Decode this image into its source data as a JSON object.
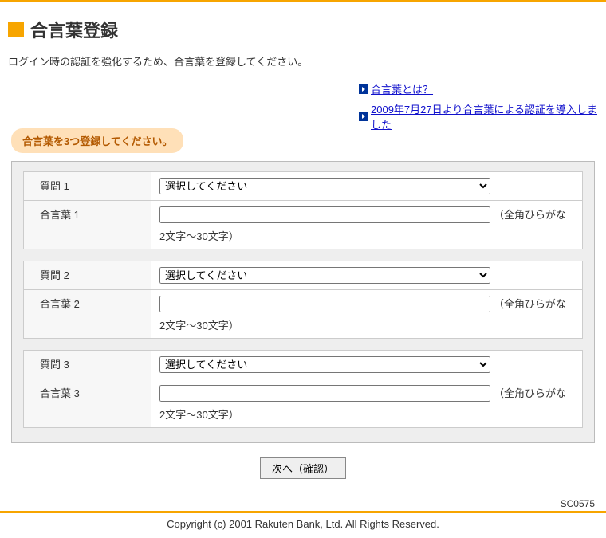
{
  "header": {
    "title": "合言葉登録"
  },
  "description": "ログイン時の認証を強化するため、合言葉を登録してください。",
  "links": {
    "whatIs": "合言葉とは？",
    "notice": "2009年7月27日より合言葉による認証を導入しました"
  },
  "instruction": "合言葉を3つ登録してください。",
  "labels": {
    "q1": "質問 1",
    "a1": "合言葉 1",
    "q2": "質問 2",
    "a2": "合言葉 2",
    "q3": "質問 3",
    "a3": "合言葉 3",
    "selectPlaceholder": "選択してください",
    "hintInline": "（全角ひらがな",
    "hintSecond": "2文字～30文字）"
  },
  "button": {
    "next": "次へ（確認）"
  },
  "footer": {
    "code": "SC0575",
    "copyright": "Copyright (c) 2001 Rakuten Bank, Ltd. All Rights Reserved."
  }
}
